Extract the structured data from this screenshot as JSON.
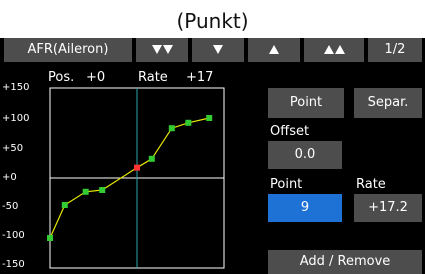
{
  "top_title": "(Punkt)",
  "header": {
    "function_name": "AFR(Aileron)",
    "btn_down_fast": "double-down-arrow-icon",
    "btn_down": "down-arrow-icon",
    "btn_up": "up-arrow-icon",
    "btn_up_fast": "double-up-arrow-icon",
    "page": "1/2"
  },
  "graph": {
    "pos_label": "Pos.",
    "pos_value": "+0",
    "rate_label": "Rate",
    "rate_value": "+17",
    "y_labels": [
      "+150",
      "+100",
      "+50",
      "+0",
      "-50",
      "-100",
      "-150"
    ]
  },
  "chart_data": {
    "type": "line",
    "x": [
      -100,
      -83,
      -59,
      -40,
      -17,
      0,
      17,
      40,
      59,
      83,
      100
    ],
    "y": [
      -100,
      -45,
      -23,
      -20,
      17.2,
      32,
      83,
      92,
      100
    ],
    "points_x": [
      -100,
      -83,
      -59,
      -40,
      0,
      17,
      40,
      59,
      83
    ],
    "points_y": [
      -100,
      -45,
      -23,
      -20,
      17.2,
      32,
      83,
      92,
      100
    ],
    "selected_point": 5,
    "colors": {
      "line": "#e8e800",
      "point": "#33cc33",
      "selected": "#ff3333",
      "center": "#2aa8a8"
    },
    "xlim": [
      -100,
      100
    ],
    "ylim": [
      -150,
      150
    ],
    "grid": false
  },
  "panel": {
    "point_button": "Point",
    "separ_button": "Separ.",
    "offset_label": "Offset",
    "offset_value": "0.0",
    "point_label": "Point",
    "point_value": "9",
    "rate_label": "Rate",
    "rate_value": "+17.2",
    "add_remove_button": "Add / Remove"
  }
}
